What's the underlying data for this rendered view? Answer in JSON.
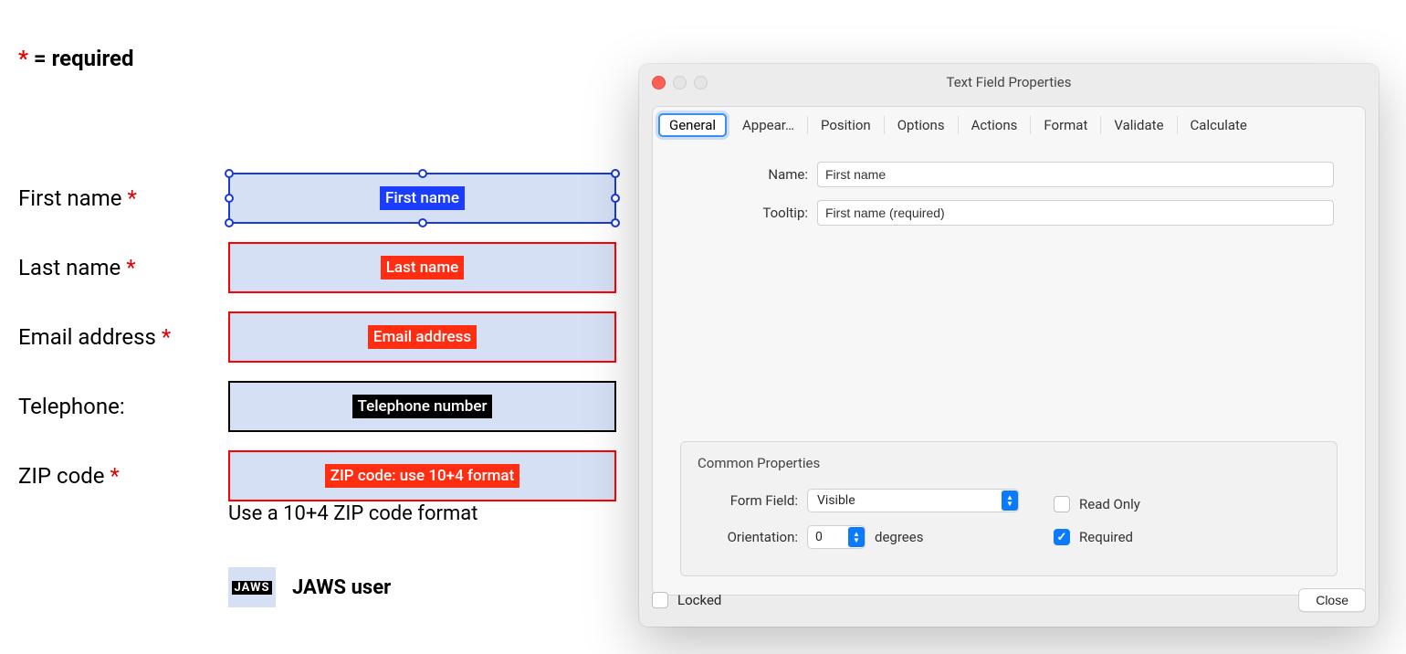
{
  "form": {
    "legend_prefix": "*",
    "legend_text": " = required",
    "hint_zip": "Use a 10+4 ZIP code format",
    "jaws_icon_text": "JAWS",
    "jaws_label": "JAWS user",
    "rows": {
      "first_name": {
        "label": "First name ",
        "req": "*",
        "tag": "First name"
      },
      "last_name": {
        "label": "Last name ",
        "req": "*",
        "tag": "Last name"
      },
      "email": {
        "label": "Email address ",
        "req": "*",
        "tag": "Email address"
      },
      "telephone": {
        "label": "Telephone:",
        "req": "",
        "tag": "Telephone number"
      },
      "zip": {
        "label": "ZIP code ",
        "req": "*",
        "tag": "ZIP code: use 10+4 format"
      }
    }
  },
  "dialog": {
    "title": "Text Field Properties",
    "tabs": {
      "general": "General",
      "appearance": "Appear…",
      "position": "Position",
      "options": "Options",
      "actions": "Actions",
      "format": "Format",
      "validate": "Validate",
      "calculate": "Calculate"
    },
    "name_label": "Name:",
    "name_value": "First name",
    "tooltip_label": "Tooltip:",
    "tooltip_value": "First name (required)",
    "common": {
      "title": "Common Properties",
      "form_field_label": "Form Field:",
      "form_field_value": "Visible",
      "orientation_label": "Orientation:",
      "orientation_value": "0",
      "orientation_suffix": "degrees",
      "read_only_label": "Read Only",
      "required_label": "Required",
      "required_checked": true,
      "read_only_checked": false
    },
    "footer": {
      "locked_label": "Locked",
      "locked_checked": false,
      "close_label": "Close"
    }
  }
}
